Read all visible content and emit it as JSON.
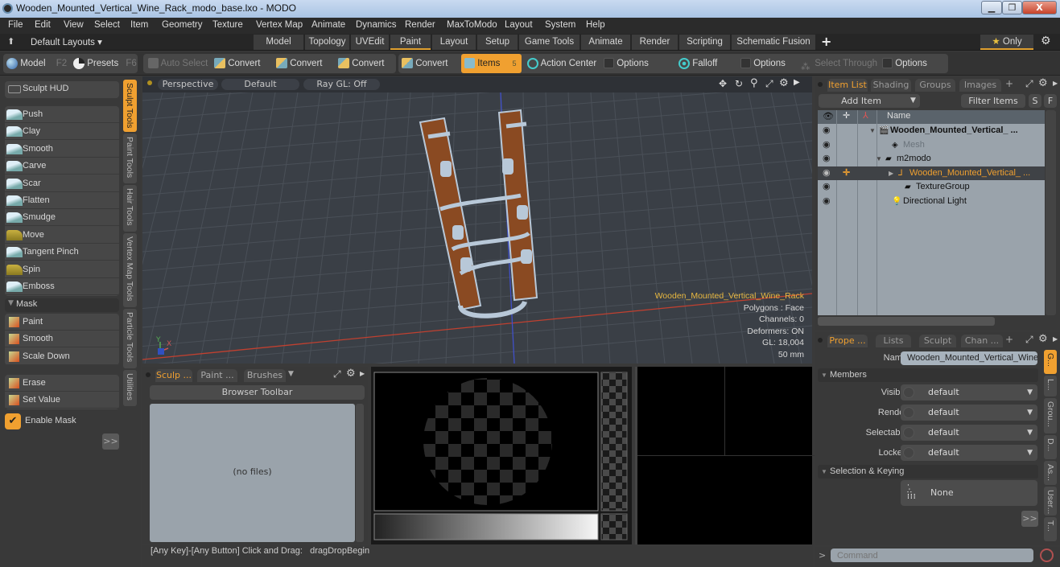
{
  "window": {
    "title": "Wooden_Mounted_Vertical_Wine_Rack_modo_base.lxo - MODO",
    "minimize_icon": "minimize-icon",
    "restore_icon": "restore-icon",
    "close_label": "X"
  },
  "menu": [
    "File",
    "Edit",
    "View",
    "Select",
    "Item",
    "Geometry",
    "Texture",
    "Vertex Map",
    "Animate",
    "Dynamics",
    "Render",
    "MaxToModo",
    "Layout",
    "System",
    "Help"
  ],
  "layouts": {
    "default_layouts": "Default Layouts ▾",
    "tabs": [
      "Model",
      "Topology",
      "UVEdit",
      "Paint",
      "Layout",
      "Setup",
      "Game Tools",
      "Animate",
      "Render",
      "Scripting",
      "Schematic Fusion"
    ],
    "active_tab": "Paint",
    "add_label": "+",
    "only_label": "Only"
  },
  "toolbar": {
    "model": "Model",
    "model_key": "F2",
    "presets": "Presets",
    "presets_key": "F6",
    "auto_select": "Auto Select",
    "convert1": "Convert",
    "convert2": "Convert",
    "convert3": "Convert",
    "convert4": "Convert",
    "items": "Items",
    "items_key": "5",
    "action_center": "Action Center",
    "options1": "Options",
    "falloff": "Falloff",
    "options2": "Options",
    "select_through": "Select Through",
    "options3": "Options"
  },
  "left_panel": {
    "sculpt_hud": "Sculpt HUD",
    "tools": [
      "Push",
      "Clay",
      "Smooth",
      "Carve",
      "Scar",
      "Flatten",
      "Smudge",
      "Move",
      "Tangent Pinch",
      "Spin",
      "Emboss"
    ],
    "mask_header": "Mask",
    "mask_tools": [
      "Paint",
      "Smooth",
      "Scale Down"
    ],
    "mask_tools2": [
      "Erase",
      "Set Value"
    ],
    "enable_mask": "Enable Mask",
    "enable_mask_checked": true,
    "more": ">>",
    "vertical_tabs": [
      "Sculpt Tools",
      "Paint Tools",
      "Hair Tools",
      "Vertex Map Tools",
      "Particle Tools",
      "Utilities"
    ],
    "active_vertical_tab": "Sculpt Tools"
  },
  "viewport": {
    "view": "Perspective",
    "shading": "Default",
    "raygl": "Ray GL: Off",
    "hud": {
      "item_name": "Wooden_Mounted_Vertical_Wine_Rack",
      "polygons": "Polygons : Face",
      "channels": "Channels: 0",
      "deformers": "Deformers: ON",
      "gl": "GL: 18,004",
      "scale": "50 mm"
    },
    "axis_y": "Y",
    "axis_x": "X"
  },
  "browser": {
    "tabs": [
      "Sculp ...",
      "Paint ...",
      "Brushes"
    ],
    "active_tab": "Sculp ...",
    "toolbar_label": "Browser Toolbar",
    "empty_text": "(no files)"
  },
  "status": {
    "text": "[Any Key]-[Any Button] Click and Drag:   dragDropBegin"
  },
  "item_list": {
    "tabs": [
      "Item List",
      "Shading",
      "Groups",
      "Images"
    ],
    "active_tab": "Item List",
    "add_item": "Add Item",
    "filter_items": "Filter Items",
    "s_btn": "S",
    "f_btn": "F",
    "name_header": "Name",
    "rows": [
      {
        "label": "Wooden_Mounted_Vertical_ ...",
        "type": "scene",
        "bold": true
      },
      {
        "label": "Mesh",
        "type": "mesh",
        "dim": true
      },
      {
        "label": "m2modo",
        "type": "group"
      },
      {
        "label": "Wooden_Mounted_Vertical_ ...",
        "type": "locator",
        "selected": true
      },
      {
        "label": "TextureGroup",
        "type": "group"
      },
      {
        "label": "Directional Light",
        "type": "light"
      }
    ]
  },
  "properties": {
    "tabs": [
      "Prope ...",
      "Lists",
      "Sculpt",
      "Chan ..."
    ],
    "active_tab": "Prope ...",
    "name_label": "Name",
    "name_value": "Wooden_Mounted_Vertical_Wine_",
    "members_header": "Members",
    "fields": [
      {
        "label": "Visible",
        "value": "default"
      },
      {
        "label": "Render",
        "value": "default"
      },
      {
        "label": "Selectable",
        "value": "default"
      },
      {
        "label": "Locked",
        "value": "default"
      }
    ],
    "selection_header": "Selection & Keying",
    "keying_value": "None",
    "more": ">>",
    "vertical_tabs": [
      "G...",
      "L...",
      "Grou...",
      "D...",
      "As...",
      "User...",
      "T..."
    ]
  },
  "command": {
    "prompt": ">",
    "placeholder": "Command"
  },
  "colors": {
    "accent": "#f0a030",
    "bg": "#393939",
    "viewport_bg": "#3a3f46",
    "tree_bg": "#9aa3ab",
    "wood": "#8a4a22"
  }
}
